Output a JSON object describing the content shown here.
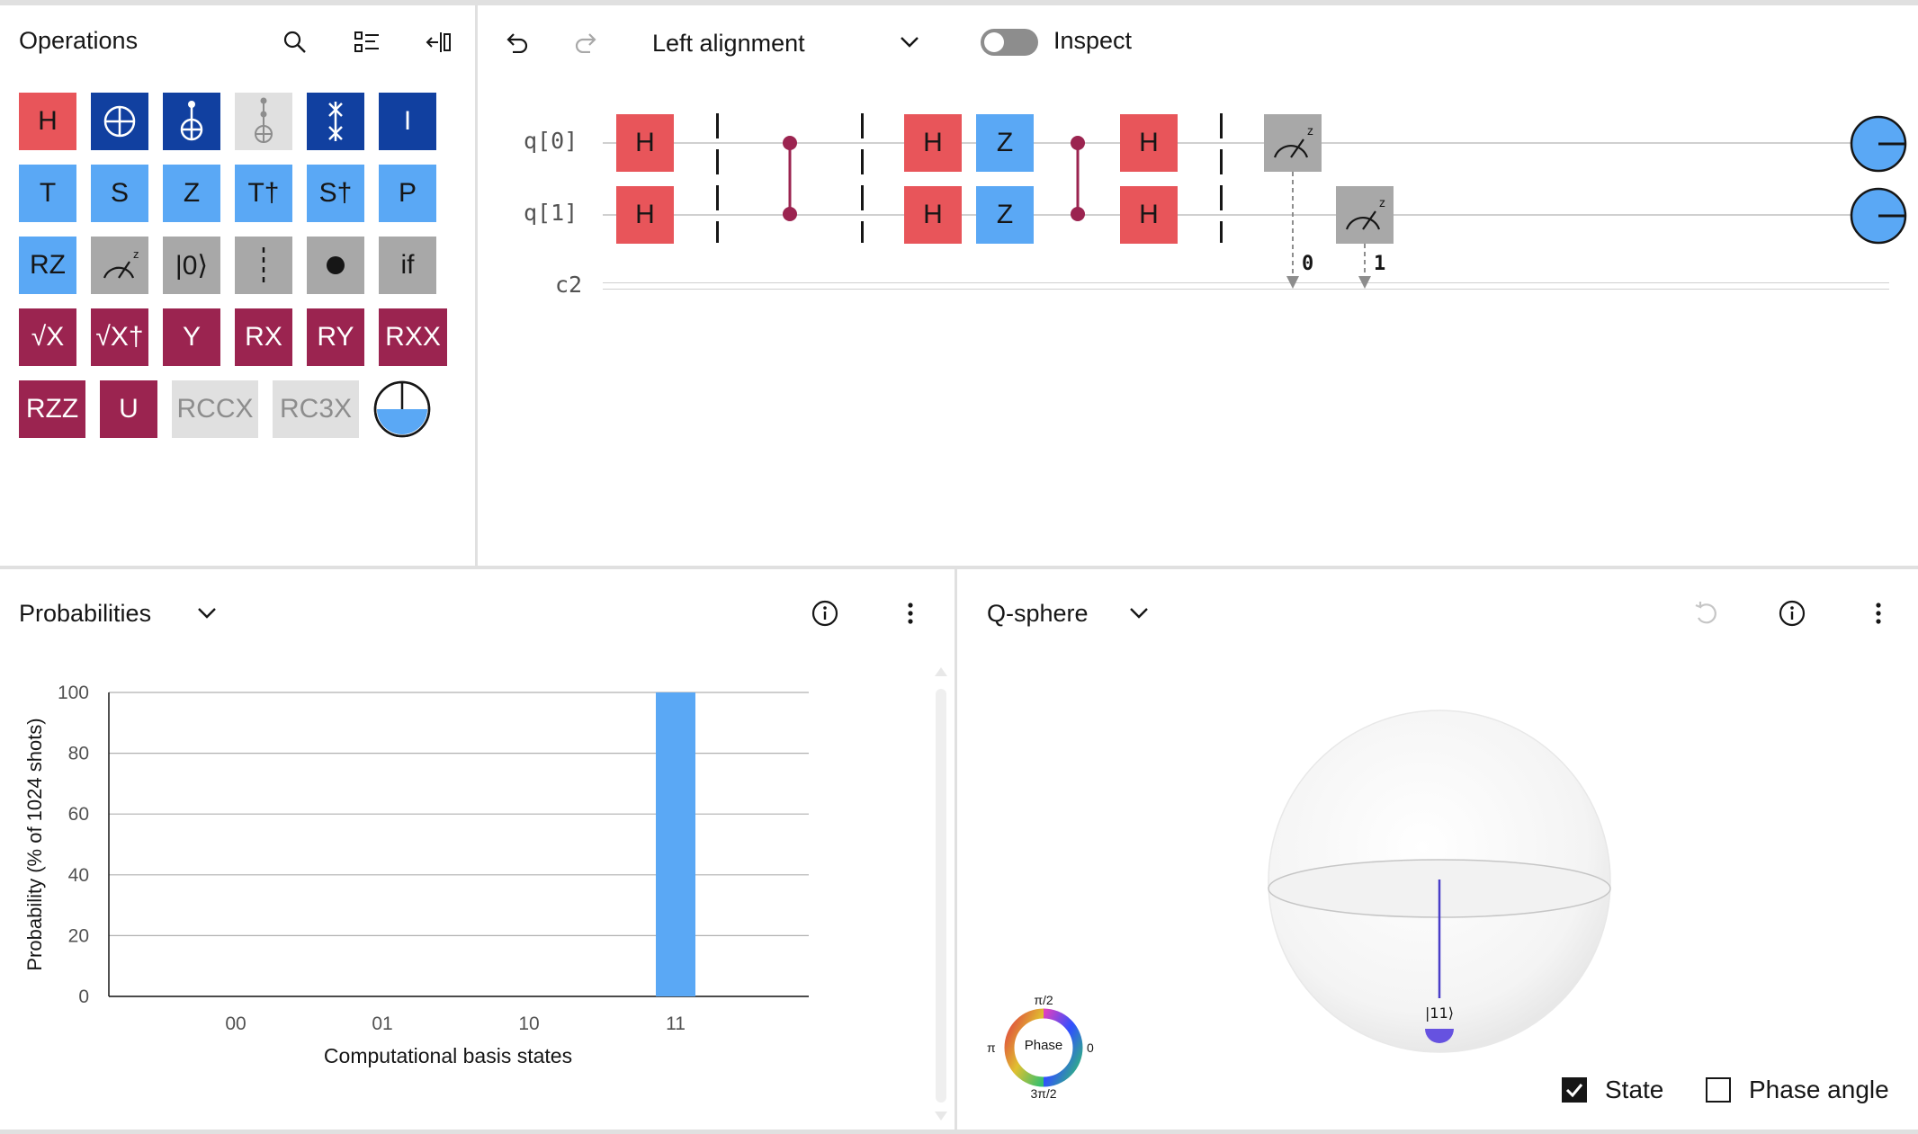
{
  "operations": {
    "title": "Operations",
    "palette": [
      [
        "H",
        "",
        "",
        "",
        "",
        "I"
      ],
      [
        "T",
        "S",
        "Z",
        "T†",
        "S†",
        "P"
      ],
      [
        "RZ",
        "",
        "|0⟩",
        "",
        "",
        "if"
      ],
      [
        "√X",
        "√X†",
        "Y",
        "RX",
        "RY",
        "RXX"
      ],
      [
        "RZZ",
        "U",
        "RCCX",
        "RC3X",
        ""
      ]
    ]
  },
  "composer": {
    "alignment": "Left alignment",
    "inspect_label": "Inspect",
    "qubits": [
      "q[0]",
      "q[1]"
    ],
    "classical": "c2",
    "gates_q0": [
      "H",
      "H",
      "Z",
      "H"
    ],
    "gates_q1": [
      "H",
      "H",
      "Z",
      "H"
    ],
    "measure_bits": [
      "0",
      "1"
    ],
    "measure_label": "z"
  },
  "probabilities": {
    "title": "Probabilities"
  },
  "chart_data": {
    "type": "bar",
    "categories": [
      "00",
      "01",
      "10",
      "11"
    ],
    "values": [
      0,
      0,
      0,
      100
    ],
    "xlabel": "Computational basis states",
    "ylabel": "Probability (% of 1024 shots)",
    "ylim": [
      0,
      100
    ],
    "yticks": [
      "0",
      "20",
      "40",
      "60",
      "80",
      "100"
    ],
    "bar_color": "#5aa8f5",
    "grid": true
  },
  "qsphere": {
    "title": "Q-sphere",
    "state_label": "|11⟩",
    "phase_center": "Phase",
    "phase_labels": {
      "top": "π/2",
      "left": "π",
      "right": "0",
      "bottom": "3π/2"
    },
    "state_checkbox": "State",
    "phase_angle_checkbox": "Phase angle"
  },
  "colors": {
    "red": "#e8555a",
    "navy": "#1140a0",
    "blue": "#5aa8f5",
    "maroon": "#9b2450",
    "gray": "#a8a8a8"
  }
}
